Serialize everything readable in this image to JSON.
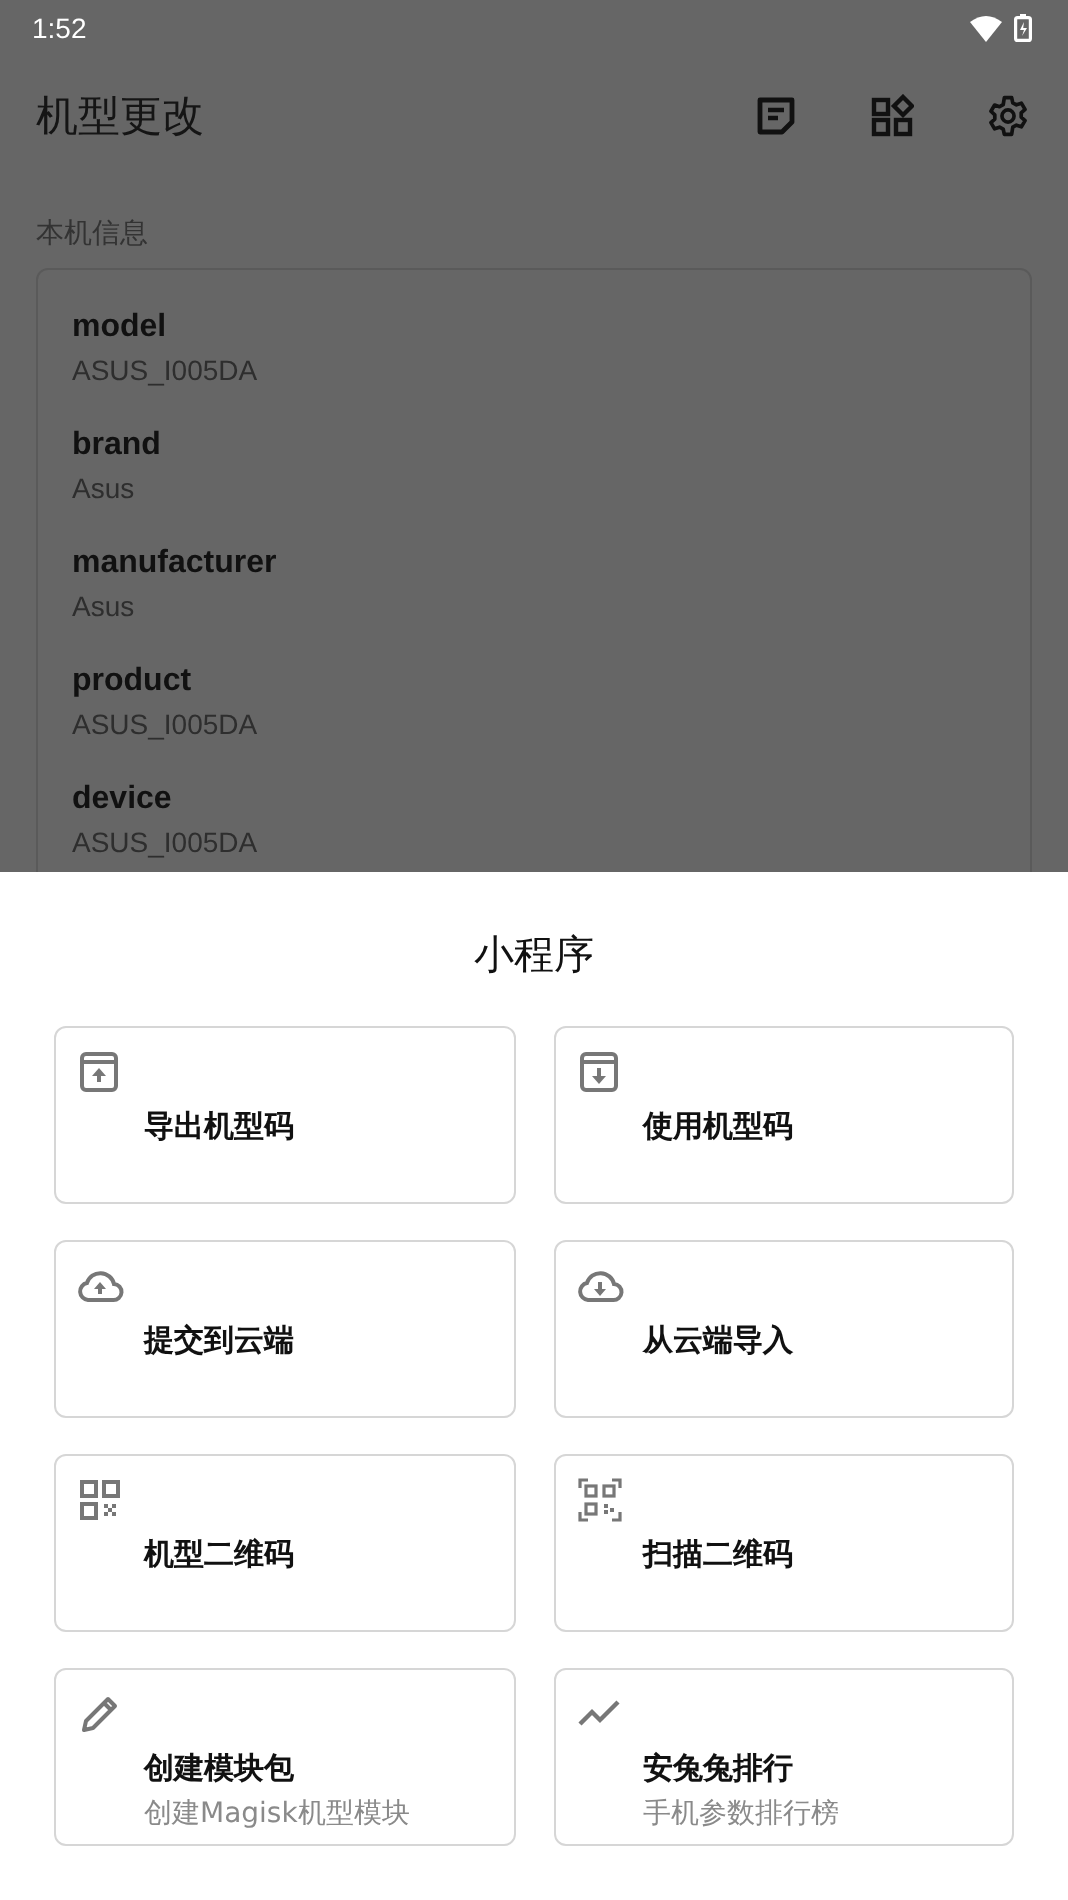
{
  "status_bar": {
    "time": "1:52"
  },
  "app_bar": {
    "title": "机型更改"
  },
  "section": {
    "label": "本机信息"
  },
  "device_info": [
    {
      "key": "model",
      "value": "ASUS_I005DA"
    },
    {
      "key": "brand",
      "value": "Asus"
    },
    {
      "key": "manufacturer",
      "value": "Asus"
    },
    {
      "key": "product",
      "value": "ASUS_I005DA"
    },
    {
      "key": "device",
      "value": "ASUS_I005DA"
    }
  ],
  "sheet": {
    "title": "小程序",
    "items": [
      {
        "title": "导出机型码"
      },
      {
        "title": "使用机型码"
      },
      {
        "title": "提交到云端"
      },
      {
        "title": "从云端导入"
      },
      {
        "title": "机型二维码"
      },
      {
        "title": "扫描二维码"
      },
      {
        "title": "创建模块包",
        "subtitle": "创建Magisk机型模块"
      },
      {
        "title": "安兔兔排行",
        "subtitle": "手机参数排行榜"
      }
    ]
  }
}
